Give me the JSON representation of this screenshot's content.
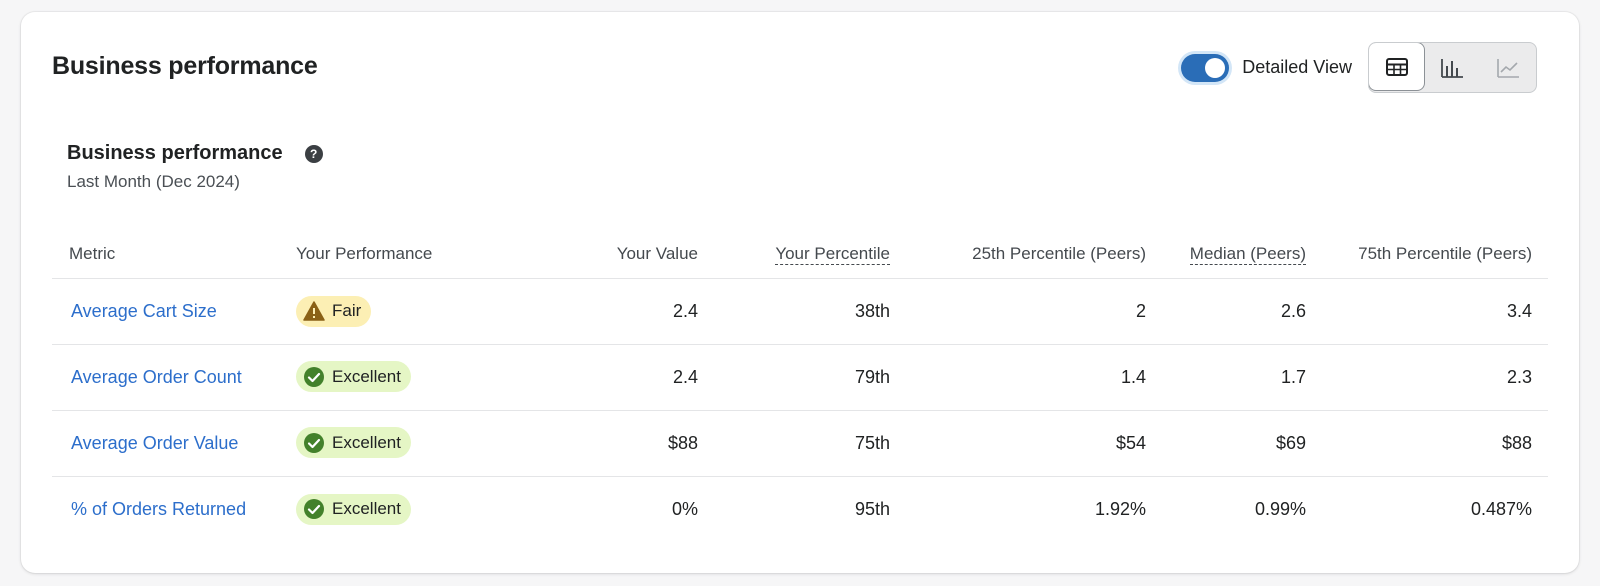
{
  "header": {
    "title": "Business performance",
    "toggle_label": "Detailed View",
    "toggle_on": true,
    "view_buttons": [
      {
        "icon": "table-icon",
        "active": true
      },
      {
        "icon": "bar-chart-icon",
        "active": false
      },
      {
        "icon": "line-chart-icon",
        "active": false
      }
    ]
  },
  "section": {
    "title": "Business performance",
    "help_glyph": "?",
    "period": "Last Month (Dec 2024)"
  },
  "table": {
    "columns": {
      "metric": "Metric",
      "performance": "Your Performance",
      "value": "Your Value",
      "percentile": "Your Percentile",
      "p25": "25th Percentile (Peers)",
      "median": "Median (Peers)",
      "p75": "75th Percentile (Peers)"
    },
    "rows": [
      {
        "metric": "Average Cart Size",
        "status": "Fair",
        "value": "2.4",
        "percentile": "38th",
        "p25": "2",
        "median": "2.6",
        "p75": "3.4"
      },
      {
        "metric": "Average Order Count",
        "status": "Excellent",
        "value": "2.4",
        "percentile": "79th",
        "p25": "1.4",
        "median": "1.7",
        "p75": "2.3"
      },
      {
        "metric": "Average Order Value",
        "status": "Excellent",
        "value": "$88",
        "percentile": "75th",
        "p25": "$54",
        "median": "$69",
        "p75": "$88"
      },
      {
        "metric": "% of Orders Returned",
        "status": "Excellent",
        "value": "0%",
        "percentile": "95th",
        "p25": "1.92%",
        "median": "0.99%",
        "p75": "0.487%"
      }
    ]
  },
  "colors": {
    "link": "#2c6ecb",
    "toggle": "#2a6db7",
    "fair_bg": "#fcefb4",
    "fair_icon": "#8a6116",
    "excellent_bg": "#e5f6c5",
    "excellent_icon": "#43812b"
  }
}
